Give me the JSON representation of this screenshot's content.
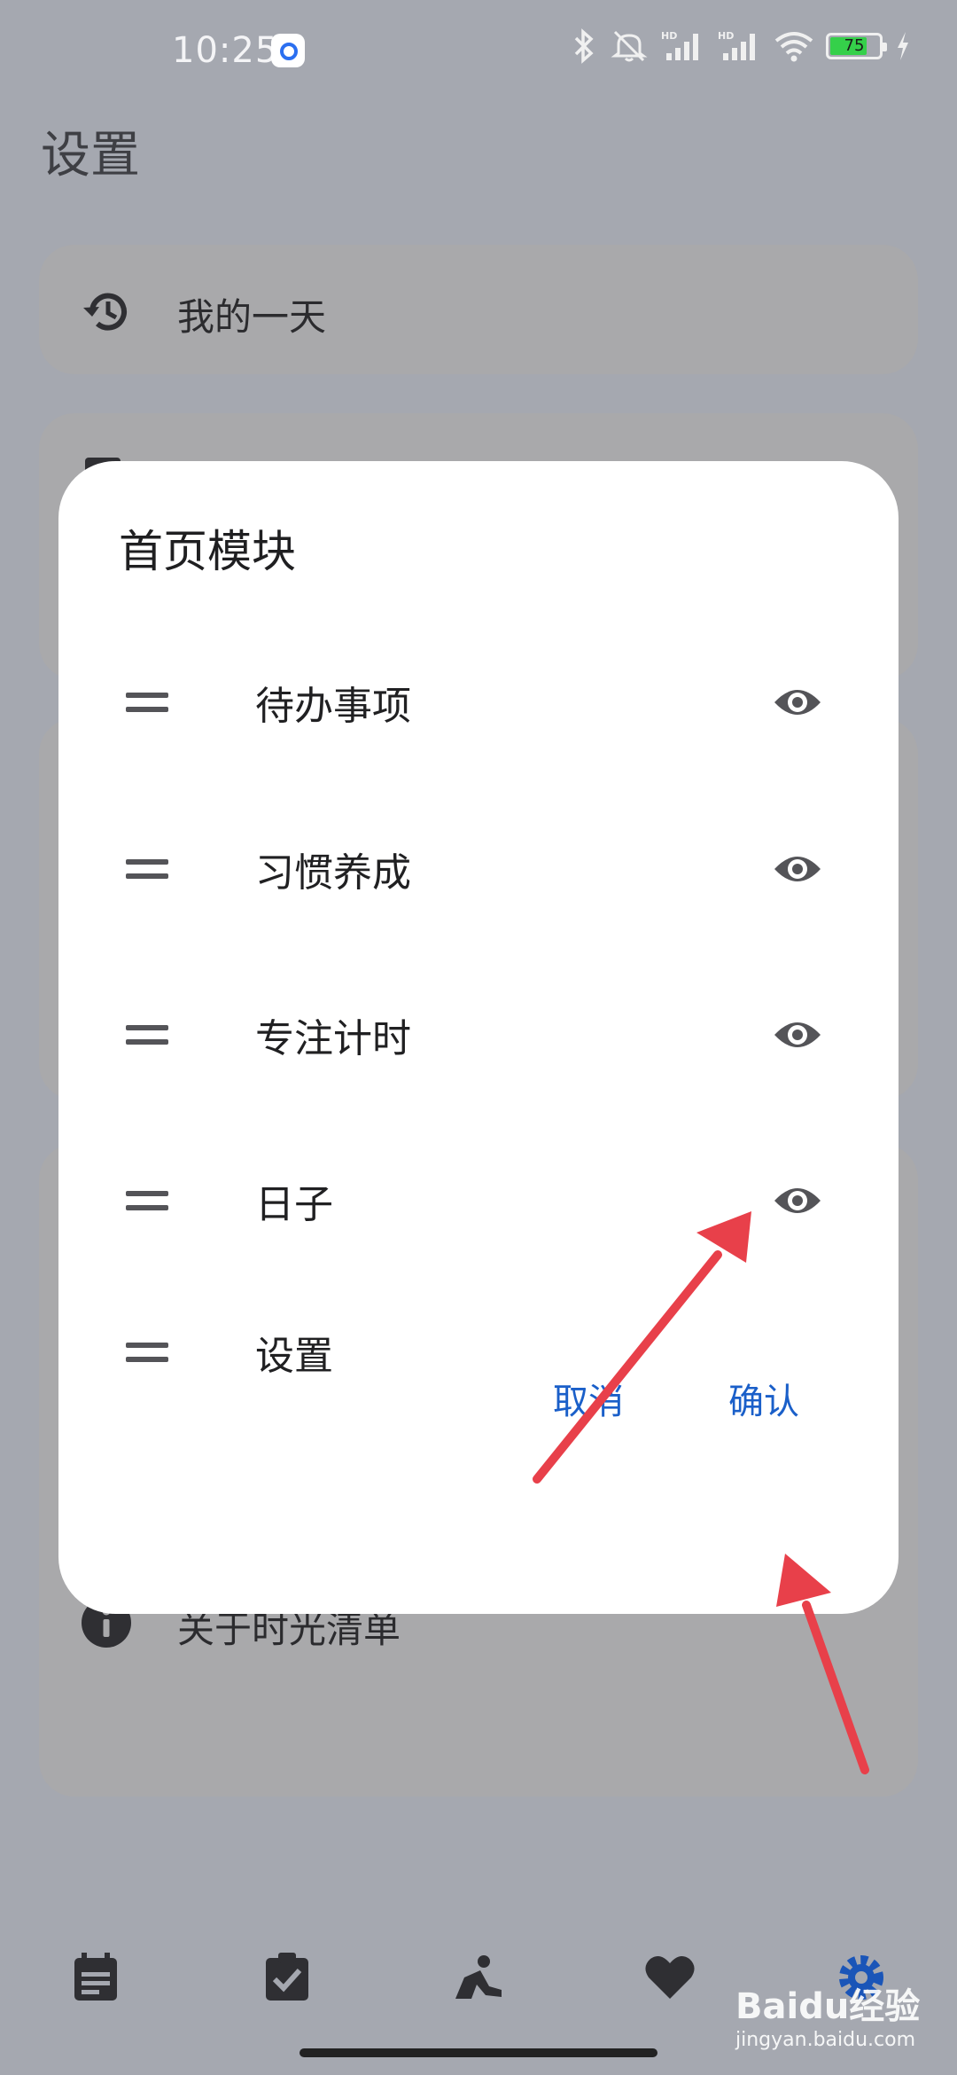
{
  "status_bar": {
    "time": "10:25",
    "battery_level": "75",
    "battery_percent": 75,
    "icons": [
      "app-notification-icon",
      "bluetooth-icon",
      "mute-icon",
      "signal-hd-icon",
      "signal-hd-icon",
      "wifi-icon",
      "battery-icon",
      "charging-icon"
    ]
  },
  "page": {
    "title": "设置",
    "cards": [
      {
        "label": "我的一天",
        "icon": "history-icon"
      },
      {
        "label": "关于时光清单",
        "icon": "info-icon"
      }
    ]
  },
  "dialog": {
    "title": "首页模块",
    "modules": [
      {
        "label": "待办事项",
        "visible": true
      },
      {
        "label": "习惯养成",
        "visible": true
      },
      {
        "label": "专注计时",
        "visible": true
      },
      {
        "label": "日子",
        "visible": true
      },
      {
        "label": "设置",
        "visible": false
      }
    ],
    "cancel_label": "取消",
    "confirm_label": "确认"
  },
  "bottom_nav": {
    "items": [
      "calendar-icon",
      "checklist-icon",
      "focus-person-icon",
      "heart-icon",
      "gear-icon"
    ]
  },
  "colors": {
    "accent": "#1a5fc9",
    "annotation_arrow": "#e8404a",
    "scrim_background": "#a5a8b0"
  },
  "watermark": {
    "brand": "Baidu经验",
    "url": "jingyan.baidu.com"
  }
}
